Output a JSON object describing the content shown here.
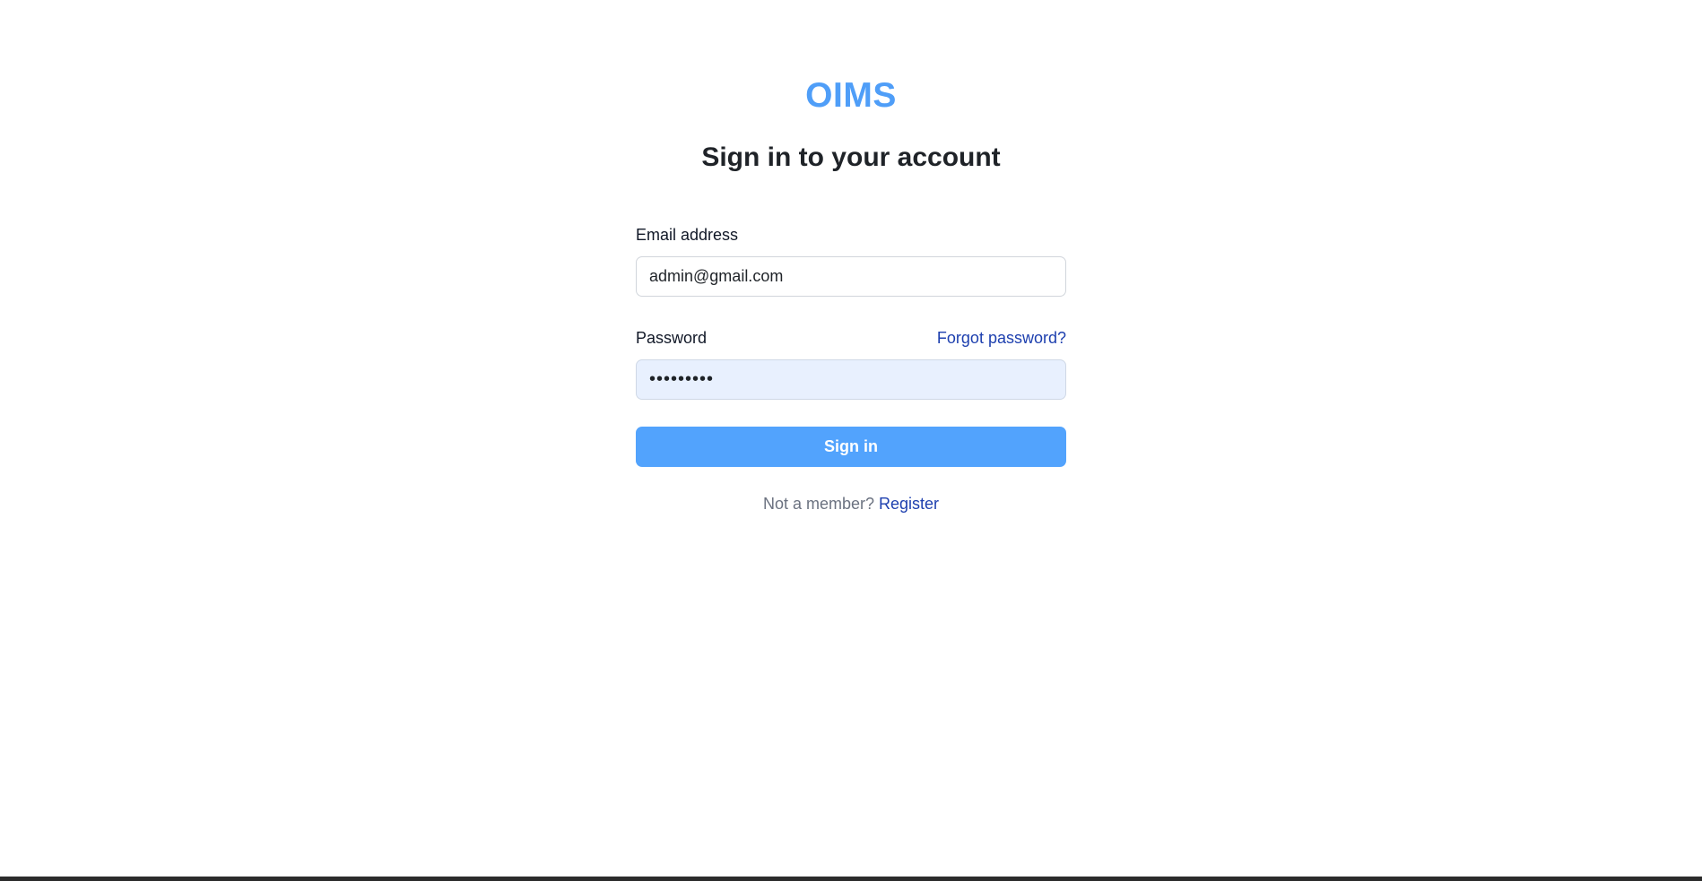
{
  "brand": {
    "name": "OIMS",
    "color": "#4f9ef8"
  },
  "page": {
    "heading": "Sign in to your account"
  },
  "form": {
    "email": {
      "label": "Email address",
      "value": "admin@gmail.com"
    },
    "password": {
      "label": "Password",
      "masked_value": "•••••••••",
      "forgot_link": "Forgot password?"
    },
    "submit_label": "Sign in",
    "submit_color": "#52a3fd"
  },
  "footer": {
    "prompt": "Not a member?",
    "register_link": "Register",
    "link_color": "#1e40af"
  }
}
